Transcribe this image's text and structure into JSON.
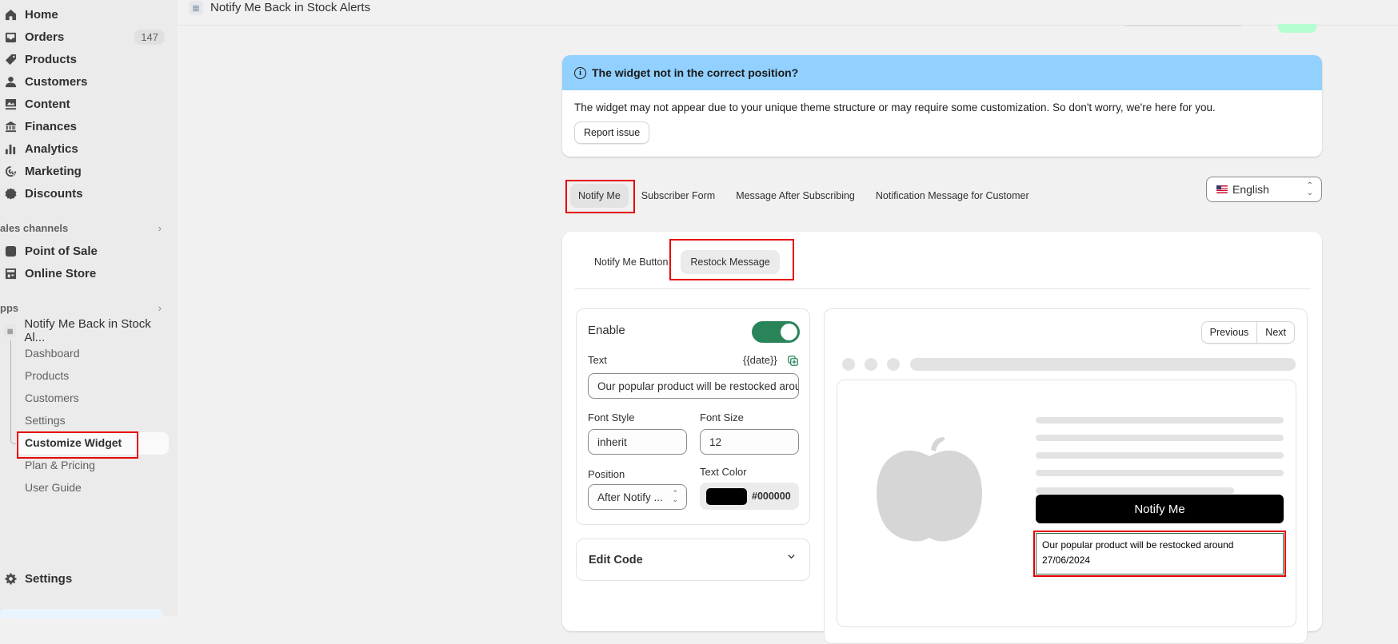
{
  "sidebar": {
    "nav": [
      {
        "label": "Home",
        "icon": "home-icon"
      },
      {
        "label": "Orders",
        "icon": "inbox-icon",
        "badge": "147"
      },
      {
        "label": "Products",
        "icon": "tag-icon"
      },
      {
        "label": "Customers",
        "icon": "person-icon"
      },
      {
        "label": "Content",
        "icon": "image-icon"
      },
      {
        "label": "Finances",
        "icon": "bank-icon"
      },
      {
        "label": "Analytics",
        "icon": "bar-chart-icon"
      },
      {
        "label": "Marketing",
        "icon": "target-icon"
      },
      {
        "label": "Discounts",
        "icon": "discount-icon"
      }
    ],
    "sales_channels_title": "ales channels",
    "sales_channels": [
      {
        "label": "Point of Sale",
        "icon": "pos-icon"
      },
      {
        "label": "Online Store",
        "icon": "store-icon"
      }
    ],
    "apps_title": "pps",
    "app": {
      "label": "Notify Me Back in Stock Al...",
      "subitems": [
        "Dashboard",
        "Products",
        "Customers",
        "Settings",
        "Customize Widget",
        "Plan & Pricing",
        "User Guide"
      ],
      "active": "Customize Widget"
    },
    "settings_label": "Settings"
  },
  "topbar": {
    "title": "Notify Me Back in Stock Alerts"
  },
  "banner": {
    "title": "The widget not in the correct position?",
    "message": "The widget may not appear due to your unique theme structure or may require some customization. So don't worry, we're here for you.",
    "button": "Report issue",
    "color": "#91d0ff"
  },
  "tabs": {
    "items": [
      "Notify Me",
      "Subscriber Form",
      "Message After Subscribing",
      "Notification Message for Customer"
    ],
    "active": "Notify Me"
  },
  "language": {
    "selected": "English",
    "flag": "us-flag"
  },
  "subtabs": {
    "items": [
      "Notify Me Button",
      "Restock Message"
    ],
    "active": "Restock Message"
  },
  "form": {
    "enable_label": "Enable",
    "enabled": true,
    "text_label": "Text",
    "date_token": "{{date}}",
    "text_value": "Our popular product will be restocked around {{date}}",
    "font_style_label": "Font Style",
    "font_style_value": "inherit",
    "font_size_label": "Font Size",
    "font_size_value": "12",
    "position_label": "Position",
    "position_value": "After Notify ...",
    "text_color_label": "Text Color",
    "text_color_value": "#000000",
    "toggle_color": "#29845a"
  },
  "edit_code": {
    "label": "Edit Code"
  },
  "preview": {
    "previous": "Previous",
    "next": "Next",
    "notify_button": "Notify Me",
    "restock_line1": "Our popular product will be restocked around",
    "restock_line2": "27/06/2024"
  }
}
